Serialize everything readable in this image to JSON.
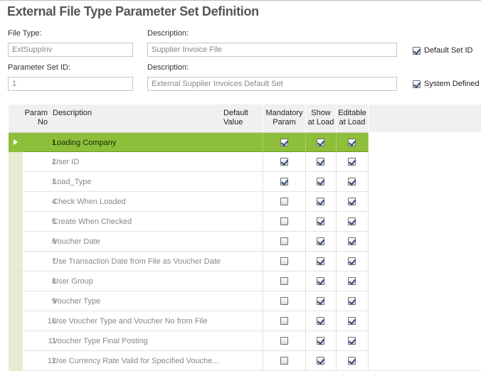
{
  "page": {
    "title": "External File Type Parameter Set Definition"
  },
  "form": {
    "file_type_label": "File Type:",
    "file_type_value": "ExtSuppInv",
    "description1_label": "Description:",
    "description1_value": "Supplier Invoice File",
    "default_set_id_label": "Default Set ID",
    "default_set_id_checked": true,
    "param_set_id_label": "Parameter Set ID:",
    "param_set_id_value": "1",
    "description2_label": "Description:",
    "description2_value": "External Supplier Invoices Default Set",
    "system_defined_label": "System Defined",
    "system_defined_checked": true
  },
  "grid": {
    "headers": {
      "param_no": "Param\nNo",
      "description": "Description",
      "default_value": "Default\nValue",
      "mandatory": "Mandatory\nParam",
      "show": "Show\nat Load",
      "editable": "Editable\nat Load"
    },
    "selected_row": 0,
    "rows": [
      {
        "no": "1",
        "description": "Loading Company",
        "mandatory": true,
        "show": true,
        "editable": true
      },
      {
        "no": "2",
        "description": "User ID",
        "mandatory": true,
        "show": true,
        "editable": true
      },
      {
        "no": "3",
        "description": "Load_Type",
        "mandatory": true,
        "show": true,
        "editable": true
      },
      {
        "no": "4",
        "description": "Check When Loaded",
        "mandatory": false,
        "show": true,
        "editable": true
      },
      {
        "no": "5",
        "description": "Create When Checked",
        "mandatory": false,
        "show": true,
        "editable": true
      },
      {
        "no": "6",
        "description": "Voucher Date",
        "mandatory": false,
        "show": true,
        "editable": true
      },
      {
        "no": "7",
        "description": "Use Transaction Date from File as Voucher Date",
        "mandatory": false,
        "show": true,
        "editable": true
      },
      {
        "no": "8",
        "description": "User Group",
        "mandatory": false,
        "show": true,
        "editable": true
      },
      {
        "no": "9",
        "description": "Voucher Type",
        "mandatory": false,
        "show": true,
        "editable": true
      },
      {
        "no": "10",
        "description": "Use Voucher Type and Voucher No from File",
        "mandatory": false,
        "show": true,
        "editable": true
      },
      {
        "no": "11",
        "description": "Voucher Type Final Posting",
        "mandatory": false,
        "show": true,
        "editable": true
      },
      {
        "no": "12",
        "description": "Use Currency Rate Valid for Specified Vouche...",
        "mandatory": false,
        "show": true,
        "editable": true
      }
    ]
  },
  "colors": {
    "selected_row": "#8dbf3a",
    "row_header": "#e4edcf"
  }
}
